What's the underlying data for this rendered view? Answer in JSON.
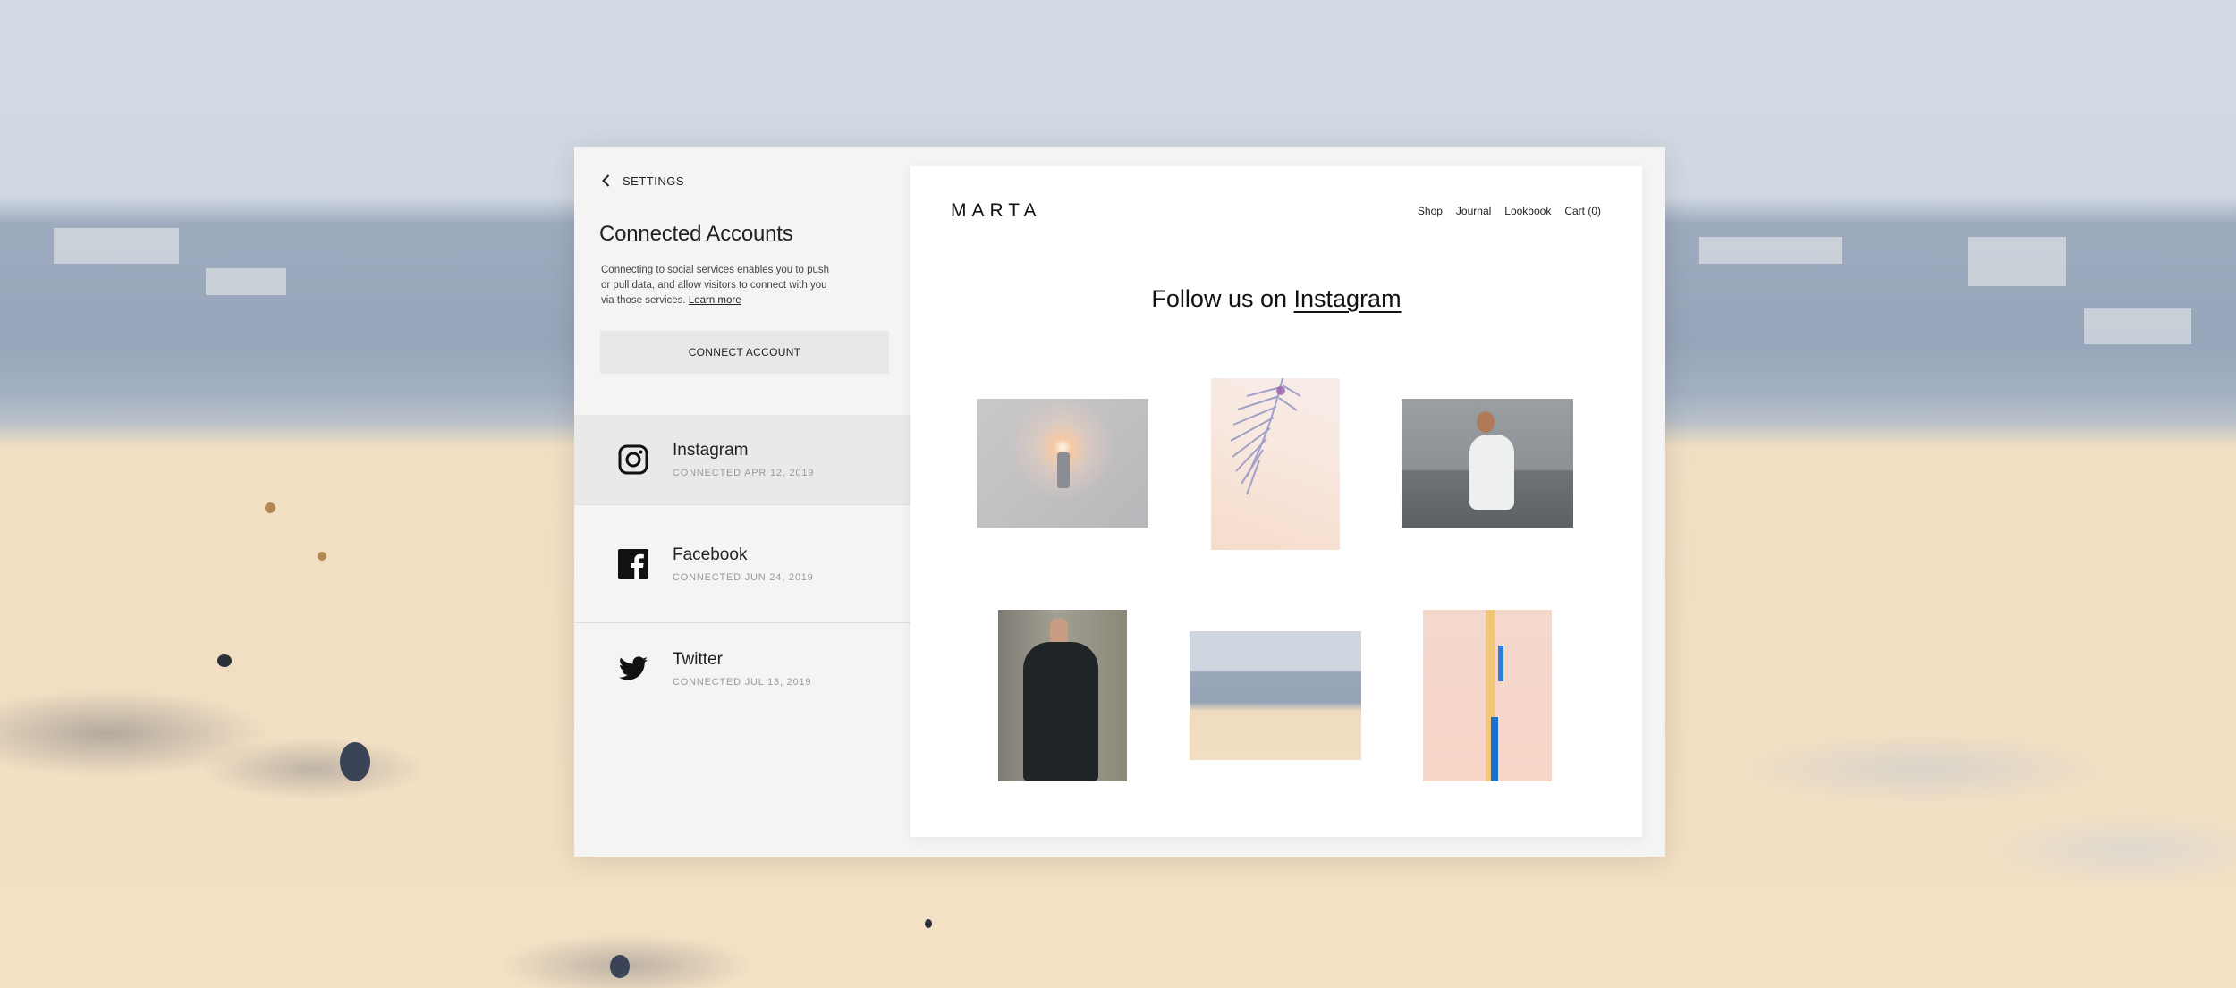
{
  "settings": {
    "back_label": "SETTINGS",
    "title": "Connected Accounts",
    "description": "Connecting to social services enables you to push or pull data, and allow visitors to connect with you via those services.",
    "learn_more": "Learn more",
    "connect_button": "CONNECT ACCOUNT",
    "accounts": [
      {
        "icon": "instagram-icon",
        "name": "Instagram",
        "connected": "CONNECTED APR 12, 2019",
        "selected": true
      },
      {
        "icon": "facebook-icon",
        "name": "Facebook",
        "connected": "CONNECTED JUN 24, 2019",
        "selected": false
      },
      {
        "icon": "twitter-icon",
        "name": "Twitter",
        "connected": "CONNECTED JUL 13, 2019",
        "selected": false
      }
    ]
  },
  "site": {
    "logo": "MARTA",
    "nav": [
      "Shop",
      "Journal",
      "Lookbook",
      "Cart (0)"
    ],
    "follow_prefix": "Follow us on",
    "follow_link": "Instagram",
    "photos": [
      "lamp-photo",
      "palm-leaf-photo",
      "woman-white-dress-photo",
      "woman-black-dress-photo",
      "wall-landscape-photo",
      "peach-wall-photo"
    ]
  },
  "colors": {
    "panel_bg": "#f4f4f4",
    "selected_row": "#e9e9e9",
    "button_bg": "#e8e8e8",
    "text": "#222222",
    "muted": "#9a9a9a"
  }
}
